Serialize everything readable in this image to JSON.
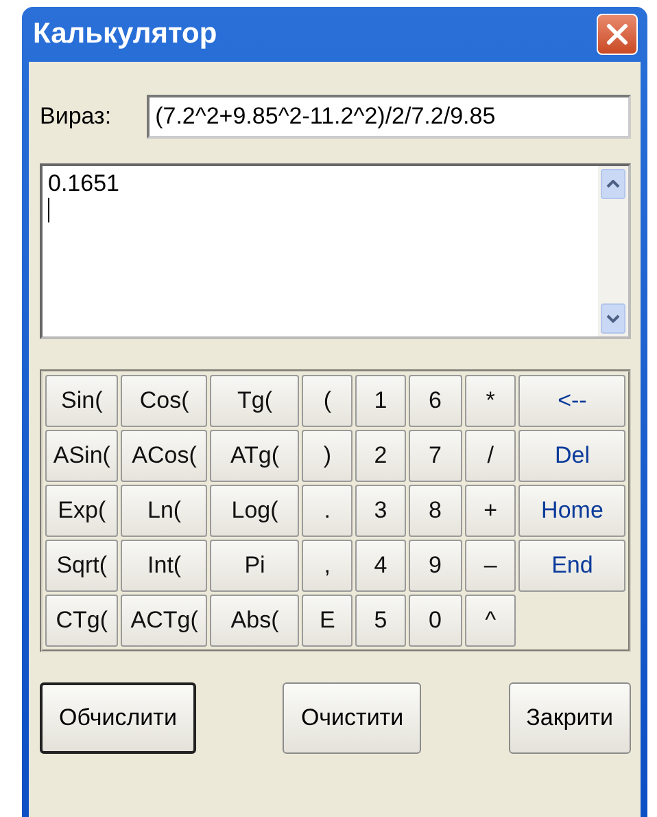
{
  "window": {
    "title": "Калькулятор"
  },
  "expression": {
    "label": "Вираз:",
    "value": "(7.2^2+9.85^2-11.2^2)/2/7.2/9.85"
  },
  "output": {
    "lines": [
      "0.1651"
    ]
  },
  "keypad": [
    [
      {
        "label": "Sin(",
        "kind": "key"
      },
      {
        "label": "Cos(",
        "kind": "key"
      },
      {
        "label": "Tg(",
        "kind": "key"
      },
      {
        "label": "(",
        "kind": "key"
      },
      {
        "label": "1",
        "kind": "key"
      },
      {
        "label": "6",
        "kind": "key"
      },
      {
        "label": "*",
        "kind": "key"
      },
      {
        "label": "<--",
        "kind": "nav"
      }
    ],
    [
      {
        "label": "ASin(",
        "kind": "key"
      },
      {
        "label": "ACos(",
        "kind": "key"
      },
      {
        "label": "ATg(",
        "kind": "key"
      },
      {
        "label": ")",
        "kind": "key"
      },
      {
        "label": "2",
        "kind": "key"
      },
      {
        "label": "7",
        "kind": "key"
      },
      {
        "label": "/",
        "kind": "key"
      },
      {
        "label": "Del",
        "kind": "nav"
      }
    ],
    [
      {
        "label": "Exp(",
        "kind": "key"
      },
      {
        "label": "Ln(",
        "kind": "key"
      },
      {
        "label": "Log(",
        "kind": "key"
      },
      {
        "label": ".",
        "kind": "key"
      },
      {
        "label": "3",
        "kind": "key"
      },
      {
        "label": "8",
        "kind": "key"
      },
      {
        "label": "+",
        "kind": "key"
      },
      {
        "label": "Home",
        "kind": "nav"
      }
    ],
    [
      {
        "label": "Sqrt(",
        "kind": "key"
      },
      {
        "label": "Int(",
        "kind": "key"
      },
      {
        "label": "Pi",
        "kind": "key"
      },
      {
        "label": ",",
        "kind": "key"
      },
      {
        "label": "4",
        "kind": "key"
      },
      {
        "label": "9",
        "kind": "key"
      },
      {
        "label": "–",
        "kind": "key"
      },
      {
        "label": "End",
        "kind": "nav"
      }
    ],
    [
      {
        "label": "CTg(",
        "kind": "key"
      },
      {
        "label": "ACTg(",
        "kind": "key"
      },
      {
        "label": "Abs(",
        "kind": "key"
      },
      {
        "label": "E",
        "kind": "key"
      },
      {
        "label": "5",
        "kind": "key"
      },
      {
        "label": "0",
        "kind": "key"
      },
      {
        "label": "^",
        "kind": "key"
      }
    ]
  ],
  "buttons": [
    {
      "label": "Обчислити",
      "default": true
    },
    {
      "label": "Очистити",
      "default": false
    },
    {
      "label": "Закрити",
      "default": false
    }
  ]
}
